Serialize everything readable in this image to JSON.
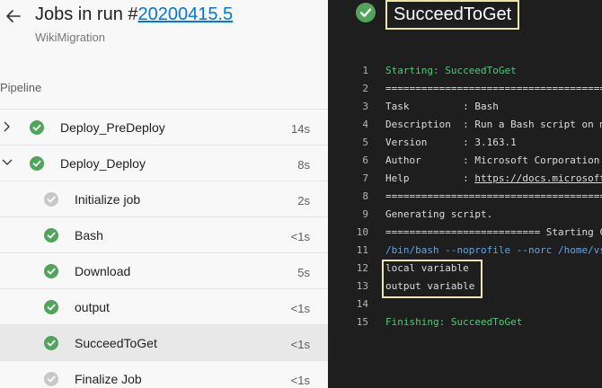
{
  "header": {
    "title_prefix": "Jobs in run #",
    "run_number": "20200415.5",
    "subtitle": "WikiMigration"
  },
  "pipeline": {
    "section_label": "Pipeline",
    "rows": [
      {
        "label": "Deploy_PreDeploy",
        "duration": "14s",
        "status": "succeeded"
      },
      {
        "label": "Deploy_Deploy",
        "duration": "8s",
        "status": "succeeded"
      },
      {
        "label": "Initialize job",
        "duration": "2s",
        "status": "skipped"
      },
      {
        "label": "Bash",
        "duration": "<1s",
        "status": "succeeded"
      },
      {
        "label": "Download",
        "duration": "5s",
        "status": "succeeded"
      },
      {
        "label": "output",
        "duration": "<1s",
        "status": "succeeded"
      },
      {
        "label": "SucceedToGet",
        "duration": "<1s",
        "status": "succeeded"
      },
      {
        "label": "Finalize Job",
        "duration": "<1s",
        "status": "skipped"
      }
    ]
  },
  "log": {
    "title": "SucceedToGet",
    "lines": [
      {
        "n": "1",
        "text": "Starting: SucceedToGet"
      },
      {
        "n": "2",
        "text": "=================================================="
      },
      {
        "n": "3",
        "text": "Task         : Bash"
      },
      {
        "n": "4",
        "text": "Description  : Run a Bash script on macOS"
      },
      {
        "n": "5",
        "text": "Version      : 3.163.1"
      },
      {
        "n": "6",
        "text": "Author       : Microsoft Corporation"
      },
      {
        "n": "7",
        "text": "Help         : "
      },
      {
        "n": "8",
        "text": "=================================================="
      },
      {
        "n": "9",
        "text": "Generating script."
      },
      {
        "n": "10",
        "text": "========================== Starting Command"
      },
      {
        "n": "11",
        "text": "/bin/bash --noprofile --norc /home/vsts/work"
      },
      {
        "n": "12",
        "text": "local variable"
      },
      {
        "n": "13",
        "text": "output variable"
      },
      {
        "n": "14",
        "text": ""
      },
      {
        "n": "15",
        "text": "Finishing: SucceedToGet"
      }
    ],
    "help_link": "https://docs.microsoft.com"
  },
  "colors": {
    "success": "#52a35b",
    "skipped": "#c8c8c8",
    "link": "#0078d4",
    "log_background": "#1e1e1e",
    "highlight": "#efe4b0"
  }
}
